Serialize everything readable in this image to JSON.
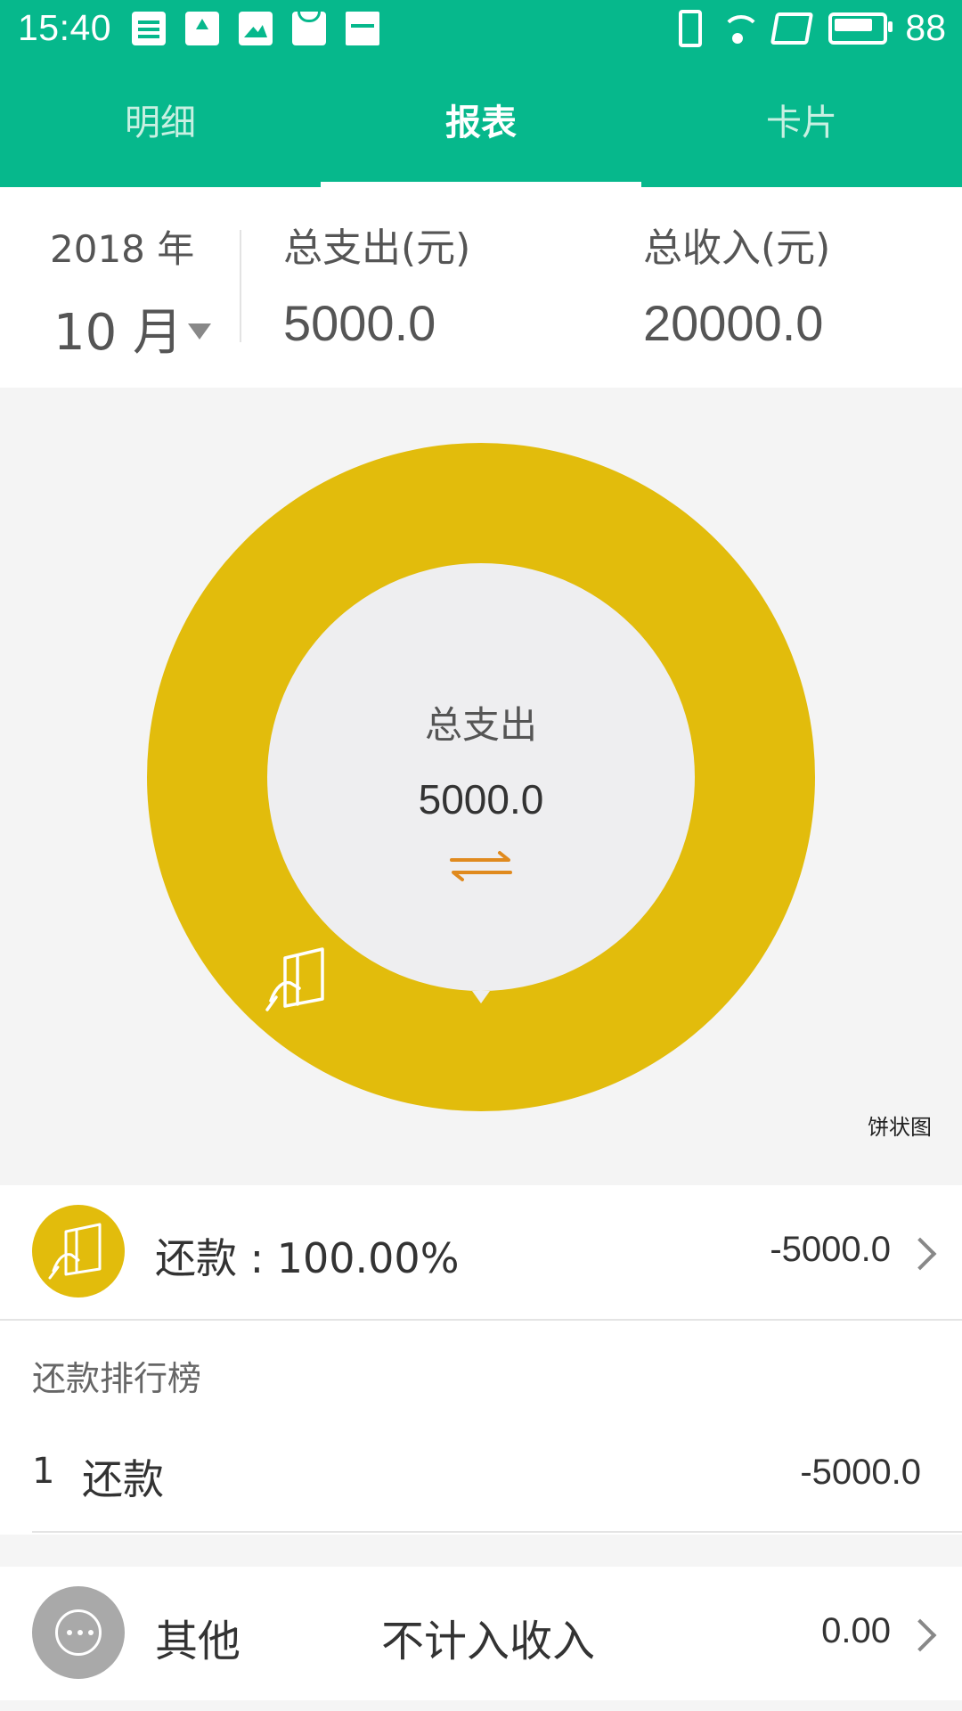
{
  "status_bar": {
    "time": "15:40",
    "battery_level": "88",
    "left_icons": [
      "news-icon",
      "upload-icon",
      "image-icon",
      "bag-icon",
      "calendar-icon"
    ],
    "right_icons": [
      "vibrate-icon",
      "wifi-icon",
      "sim-icon",
      "battery-icon"
    ]
  },
  "tabs": [
    {
      "label": "明细",
      "active": false
    },
    {
      "label": "报表",
      "active": true
    },
    {
      "label": "卡片",
      "active": false
    }
  ],
  "summary": {
    "year": "2018 年",
    "month": "10 月",
    "expense_label": "总支出(元)",
    "expense_value": "5000.0",
    "income_label": "总收入(元)",
    "income_value": "20000.0"
  },
  "chart_data": {
    "type": "pie",
    "categories": [
      "还款"
    ],
    "values": [
      5000.0
    ],
    "colors": [
      "#e2bc0c"
    ],
    "center_label": "总支出",
    "center_value": "5000.0",
    "caption": "饼状图"
  },
  "category_row": {
    "text": "还款 : 100.00%",
    "amount": "-5000.0",
    "color": "#e2bc0c",
    "icon": "card-hand-icon"
  },
  "ranking": {
    "title": "还款排行榜",
    "rows": [
      {
        "rank": "1",
        "name": "还款",
        "amount": "-5000.0"
      }
    ]
  },
  "other_row": {
    "name": "其他",
    "note": "不计入收入",
    "amount": "0.00",
    "icon": "more-icon"
  },
  "colors": {
    "brand": "#06b88c",
    "segment": "#e2bc0c",
    "swap_icon": "#e08a1e",
    "other_badge": "#a9a9a9"
  }
}
